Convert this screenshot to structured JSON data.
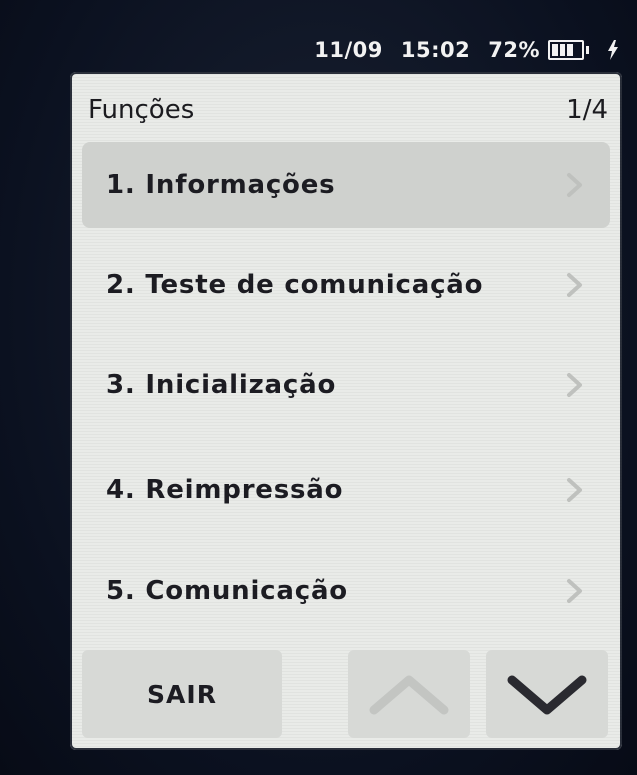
{
  "status": {
    "date": "11/09",
    "time": "15:02",
    "battery_percent": "72%",
    "battery_level": 0.72,
    "charging": true
  },
  "header": {
    "title": "Funções",
    "page": "1/4"
  },
  "menu": {
    "items": [
      {
        "label": "1. Informações",
        "selected": true
      },
      {
        "label": "2. Teste de comunicação",
        "selected": false
      },
      {
        "label": "3. Inicialização",
        "selected": false
      },
      {
        "label": "4. Reimpressão",
        "selected": false
      },
      {
        "label": "5. Comunicação",
        "selected": false
      }
    ]
  },
  "footer": {
    "exit_label": "SAIR",
    "up_icon": "chevron-up-icon",
    "down_icon": "chevron-down-icon"
  },
  "colors": {
    "screen_bg": "#e9ebe8",
    "selected_bg": "#cfd1ce",
    "text": "#1c1c22",
    "disabled_arrow": "#bfc1be"
  }
}
